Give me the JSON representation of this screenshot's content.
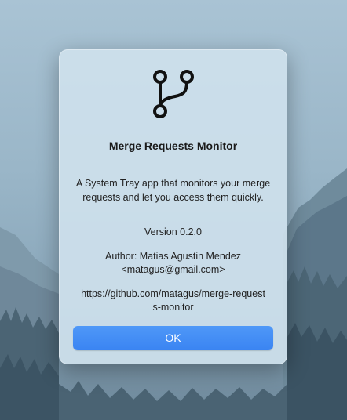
{
  "dialog": {
    "app_icon": "git-merge-icon",
    "title": "Merge Requests Monitor",
    "description": "A System Tray app that monitors your merge requests and let you access them quickly.",
    "version": "Version 0.2.0",
    "author_line1": "Author: Matias Agustin Mendez",
    "author_line2": "<matagus@gmail.com>",
    "url": "https://github.com/matagus/merge-requests-monitor",
    "ok_label": "OK"
  },
  "colors": {
    "accent": "#3a84f2",
    "dialog_bg": "#cde0ec",
    "wallpaper_sky": "#a9c3d4"
  }
}
